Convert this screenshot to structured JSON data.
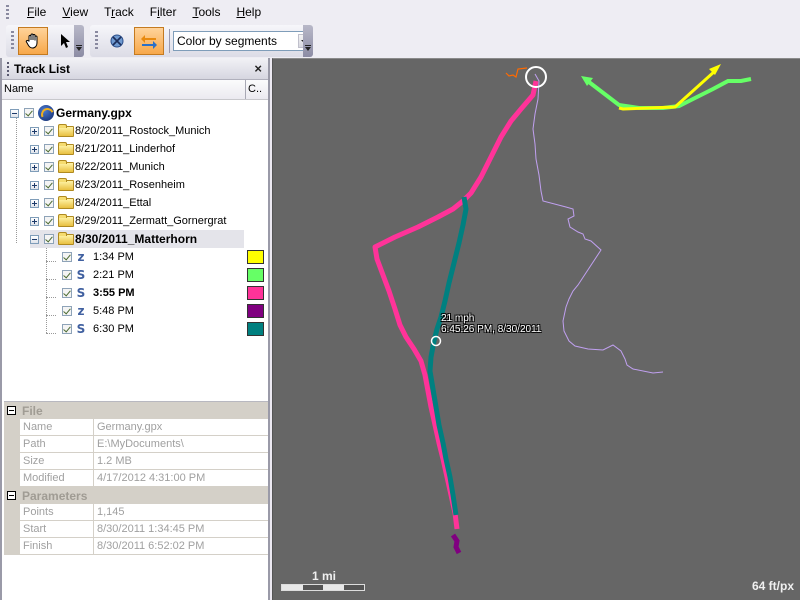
{
  "menu": [
    {
      "label": "File",
      "accel": "F"
    },
    {
      "label": "View",
      "accel": "V"
    },
    {
      "label": "Track",
      "accel": "r"
    },
    {
      "label": "Filter",
      "accel": "i"
    },
    {
      "label": "Tools",
      "accel": "T"
    },
    {
      "label": "Help",
      "accel": "H"
    }
  ],
  "toolbar": {
    "pan_tool": "hand-icon",
    "select_tool": "arrow-pointer-icon",
    "clear_button": "clear-icon",
    "swap_button": "swap-arrows-icon",
    "color_mode": {
      "selected": "Color by segments"
    }
  },
  "track_list": {
    "title": "Track List",
    "close": "×",
    "columns": {
      "name": "Name",
      "color": "C.."
    },
    "root": {
      "label": "Germany.gpx",
      "checked": true,
      "expanded": true
    },
    "folders": [
      {
        "label": "8/20/2011_Rostock_Munich",
        "checked": true,
        "expanded": false
      },
      {
        "label": "8/21/2011_Linderhof",
        "checked": true,
        "expanded": false
      },
      {
        "label": "8/22/2011_Munich",
        "checked": true,
        "expanded": false
      },
      {
        "label": "8/23/2011_Rosenheim",
        "checked": true,
        "expanded": false
      },
      {
        "label": "8/24/2011_Ettal",
        "checked": true,
        "expanded": false
      },
      {
        "label": "8/29/2011_Zermatt_Gornergrat",
        "checked": true,
        "expanded": false
      },
      {
        "label": "8/30/2011_Matterhorn",
        "checked": true,
        "expanded": true,
        "selected": true
      }
    ],
    "tracks": [
      {
        "label": "1:34 PM",
        "checked": true,
        "icon": "z",
        "color": "#ffff00",
        "bold": false
      },
      {
        "label": "2:21 PM",
        "checked": true,
        "icon": "S",
        "color": "#66ff66",
        "bold": false
      },
      {
        "label": "3:55 PM",
        "checked": true,
        "icon": "S",
        "color": "#ff3399",
        "bold": true
      },
      {
        "label": "5:48 PM",
        "checked": true,
        "icon": "z",
        "color": "#800080",
        "bold": false
      },
      {
        "label": "6:30 PM",
        "checked": true,
        "icon": "S",
        "color": "#008080",
        "bold": false
      }
    ]
  },
  "properties": {
    "categories": [
      {
        "name": "File",
        "rows": [
          {
            "key": "Name",
            "value": "Germany.gpx"
          },
          {
            "key": "Path",
            "value": "E:\\MyDocuments\\"
          },
          {
            "key": "Size",
            "value": "1.2 MB"
          },
          {
            "key": "Modified",
            "value": "4/17/2012 4:31:00 PM"
          }
        ]
      },
      {
        "name": "Parameters",
        "rows": [
          {
            "key": "Points",
            "value": "1,145"
          },
          {
            "key": "Start",
            "value": "8/30/2011 1:34:45 PM"
          },
          {
            "key": "Finish",
            "value": "8/30/2011 6:52:02 PM"
          }
        ]
      }
    ]
  },
  "map": {
    "tooltip": {
      "speed": "21 mph",
      "time": "6:45:26 PM, 8/30/2011"
    },
    "scale_label": "1 mi",
    "resolution": "64 ft/px",
    "background": "#666666",
    "track_colors": {
      "pink": "#ff3399",
      "teal": "#008080",
      "green": "#66ff66",
      "yellow": "#ffff00",
      "purple": "#800080",
      "lavender": "#c0a0f0",
      "orange": "#ff6a00"
    }
  }
}
